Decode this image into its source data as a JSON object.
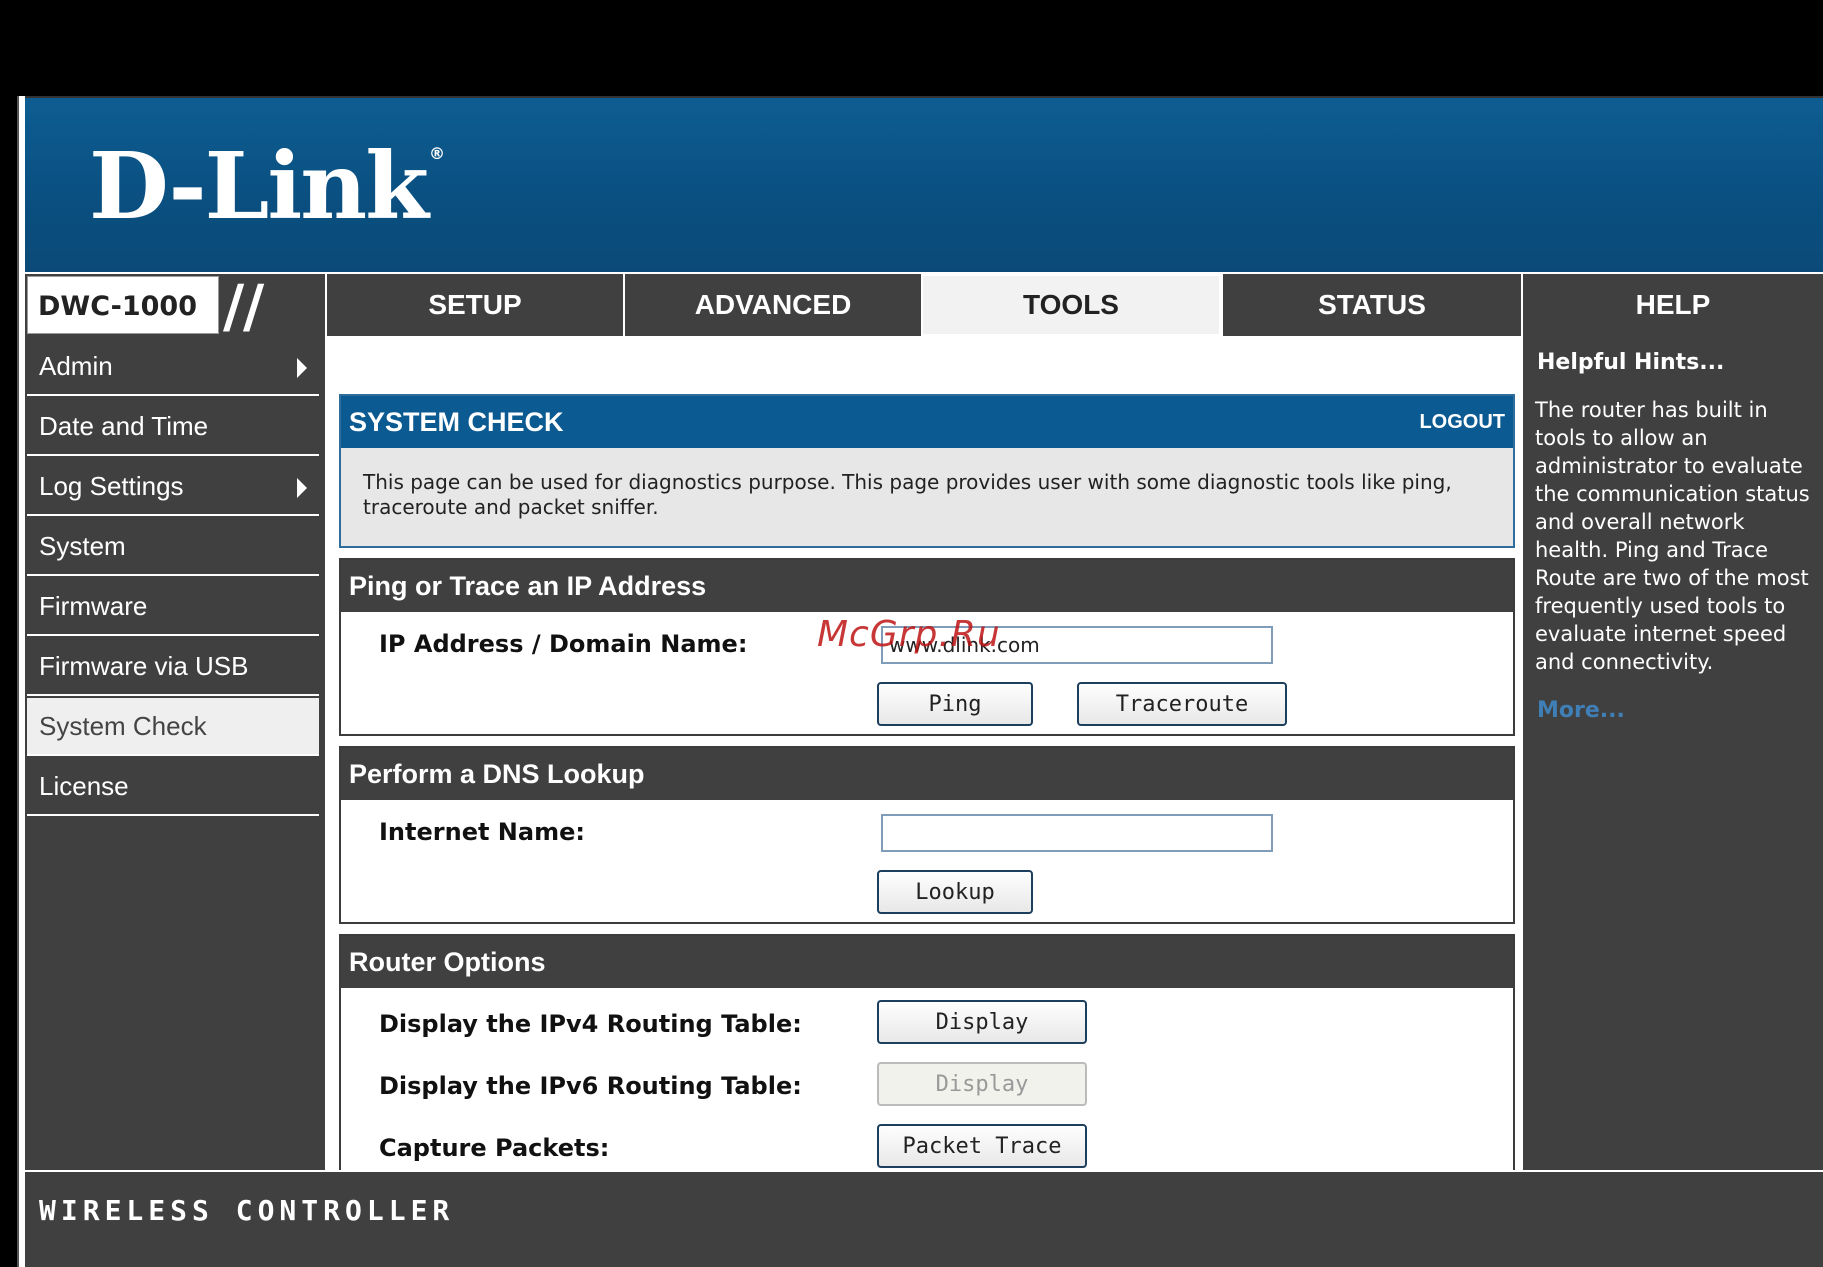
{
  "brand": {
    "logo": "D-Link",
    "registered": "®",
    "model": "DWC-1000"
  },
  "nav": {
    "tabs": [
      {
        "label": "SETUP"
      },
      {
        "label": "ADVANCED"
      },
      {
        "label": "TOOLS",
        "active": true
      },
      {
        "label": "STATUS"
      },
      {
        "label": "HELP"
      }
    ]
  },
  "sidebar": {
    "items": [
      {
        "label": "Admin",
        "submenu": true
      },
      {
        "label": "Date and Time"
      },
      {
        "label": "Log Settings",
        "submenu": true
      },
      {
        "label": "System"
      },
      {
        "label": "Firmware"
      },
      {
        "label": "Firmware via USB"
      },
      {
        "label": "System Check",
        "active": true
      },
      {
        "label": "License"
      }
    ]
  },
  "system_check": {
    "title": "SYSTEM CHECK",
    "logout": "LOGOUT",
    "description": "This page can be used for diagnostics purpose. This page provides user with some diagnostic tools like ping, traceroute and packet sniffer."
  },
  "ping": {
    "title": "Ping or Trace an IP Address",
    "label": "IP Address / Domain Name:",
    "value": "www.dlink.com",
    "ping_button": "Ping",
    "traceroute_button": "Traceroute"
  },
  "dns": {
    "title": "Perform a DNS Lookup",
    "label": "Internet Name:",
    "value": "",
    "lookup_button": "Lookup"
  },
  "router": {
    "title": "Router Options",
    "ipv4_label": "Display the IPv4 Routing Table:",
    "ipv4_button": "Display",
    "ipv6_label": "Display the IPv6 Routing Table:",
    "ipv6_button": "Display",
    "capture_label": "Capture Packets:",
    "capture_button": "Packet Trace"
  },
  "hints": {
    "title": "Helpful Hints...",
    "text": "The router has built in tools to allow an administrator to evaluate the communication status and overall network health. Ping and Trace Route are two of the most frequently used tools to evaluate internet speed and connectivity.",
    "more": "More..."
  },
  "footer": {
    "text": "WIRELESS CONTROLLER"
  },
  "watermark": {
    "text": "McGrp.Ru"
  },
  "colors": {
    "header_blue": "#0b5a91",
    "nav_gray": "#404040",
    "link_blue": "#3f7fb6",
    "watermark_red": "#be1414"
  }
}
